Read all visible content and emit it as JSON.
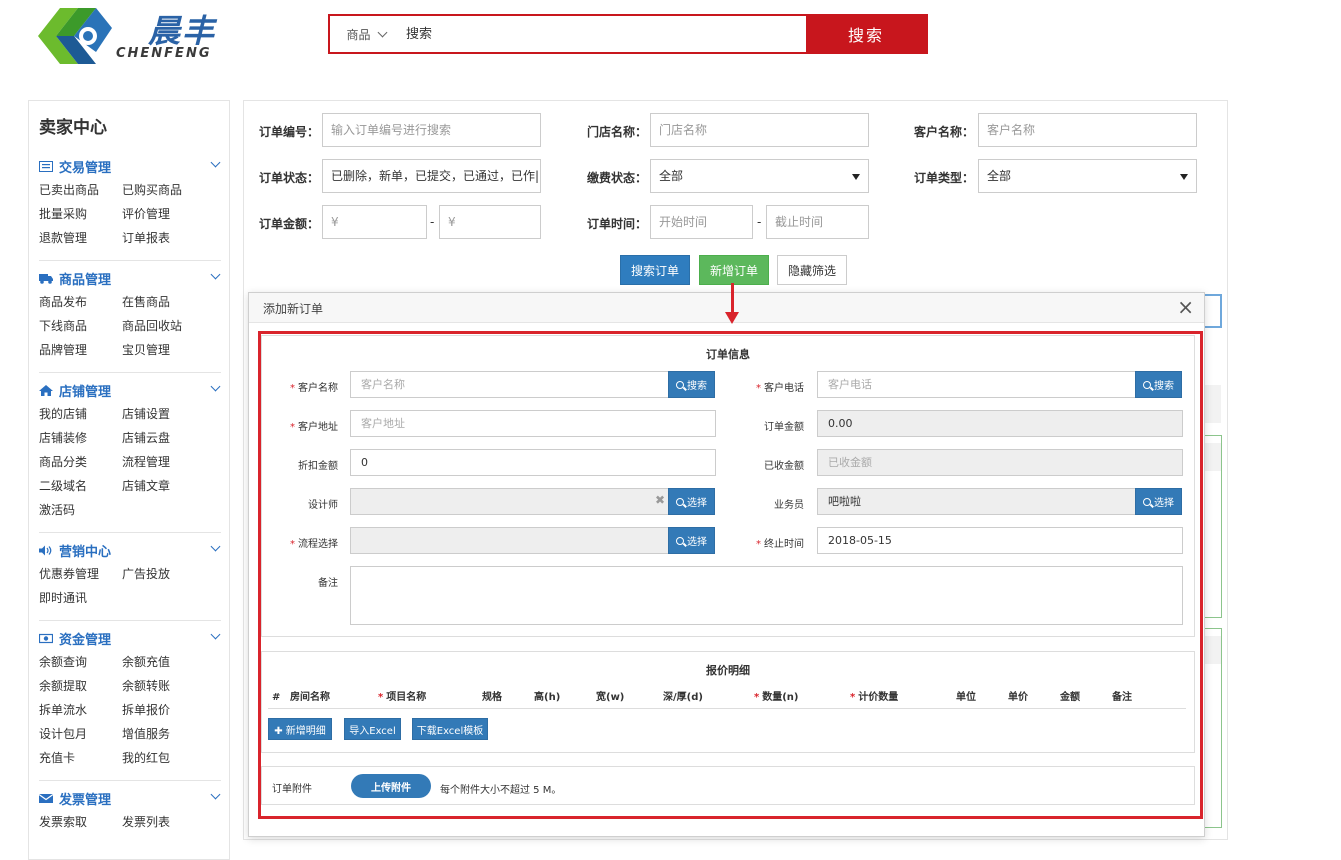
{
  "brand": {
    "name_cn": "晨丰",
    "name_en": "CHENFENG"
  },
  "search": {
    "category": "商品",
    "placeholder": "搜索",
    "button": "搜索"
  },
  "sidebar": {
    "title": "卖家中心",
    "sections": [
      {
        "title": "交易管理",
        "icon": "list-icon",
        "items": [
          "已卖出商品",
          "已购买商品",
          "批量采购",
          "评价管理",
          "退款管理",
          "订单报表"
        ]
      },
      {
        "title": "商品管理",
        "icon": "truck-icon",
        "items": [
          "商品发布",
          "在售商品",
          "下线商品",
          "商品回收站",
          "品牌管理",
          "宝贝管理"
        ]
      },
      {
        "title": "店铺管理",
        "icon": "home-icon",
        "items": [
          "我的店铺",
          "店铺设置",
          "店铺装修",
          "店铺云盘",
          "商品分类",
          "流程管理",
          "二级域名",
          "店铺文章",
          "激活码"
        ]
      },
      {
        "title": "营销中心",
        "icon": "volume-icon",
        "items": [
          "优惠券管理",
          "广告投放",
          "即时通讯"
        ]
      },
      {
        "title": "资金管理",
        "icon": "money-icon",
        "items": [
          "余额查询",
          "余额充值",
          "余额提取",
          "余额转账",
          "拆单流水",
          "拆单报价",
          "设计包月",
          "增值服务",
          "充值卡",
          "我的红包"
        ]
      },
      {
        "title": "发票管理",
        "icon": "envelope-icon",
        "items": [
          "发票索取",
          "发票列表"
        ]
      }
    ]
  },
  "filters": {
    "order_no_label": "订单编号：",
    "order_no_placeholder": "输入订单编号进行搜索",
    "store_label": "门店名称：",
    "store_placeholder": "门店名称",
    "customer_label": "客户名称：",
    "customer_placeholder": "客户名称",
    "status_label": "订单状态：",
    "status_value": "已删除，新单，已提交，已通过，已作|",
    "pay_label": "缴费状态：",
    "pay_value": "全部",
    "type_label": "订单类型：",
    "type_value": "全部",
    "amount_label": "订单金额：",
    "amount_min": "¥",
    "amount_max": "¥",
    "dash": "-",
    "time_label": "订单时间：",
    "time_start": "开始时间",
    "time_end": "截止时间",
    "btn_search": "搜索订单",
    "btn_new": "新增订单",
    "btn_hide": "隐藏筛选"
  },
  "modal": {
    "title": "添加新订单",
    "close": "×",
    "info_title": "订单信息",
    "customer_name_label": "客户名称",
    "customer_name_placeholder": "客户名称",
    "search_btn": "搜索",
    "customer_phone_label": "客户电话",
    "customer_phone_placeholder": "客户电话",
    "address_label": "客户地址",
    "address_placeholder": "客户地址",
    "amount_label": "订单金额",
    "amount_value": "0.00",
    "discount_label": "折扣金额",
    "discount_value": "0",
    "received_label": "已收金额",
    "received_placeholder": "已收金额",
    "designer_label": "设计师",
    "select_btn": "选择",
    "clear": "✖",
    "salesman_label": "业务员",
    "salesman_value": "吧啦啦",
    "process_label": "流程选择",
    "deadline_label": "终止时间",
    "deadline_value": "2018-05-15",
    "remark_label": "备注",
    "quote_title": "报价明细",
    "columns": [
      "#",
      "房间名称",
      "项目名称",
      "规格",
      "高(h)",
      "宽(w)",
      "深/厚(d)",
      "数量(n)",
      "计价数量",
      "单位",
      "单价",
      "金额",
      "备注"
    ],
    "btn_add_detail": "✚ 新增明细",
    "btn_import": "导入Excel",
    "btn_download": "下载Excel模板",
    "attach_label": "订单附件",
    "upload_btn": "上传附件",
    "attach_hint": "每个附件大小不超过 5 M。"
  },
  "colors": {
    "brand_red": "#c8161d",
    "link_blue": "#2a6fc0",
    "primary": "#337ab7",
    "success": "#5cb85c",
    "highlight": "#d9242c"
  }
}
